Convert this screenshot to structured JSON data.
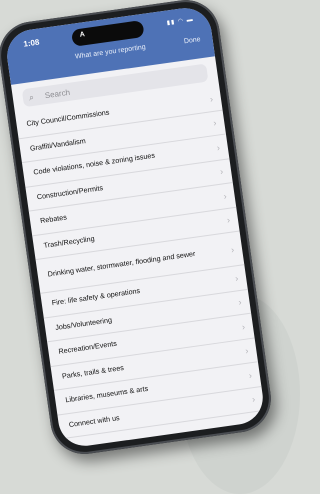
{
  "status": {
    "time": "1:08",
    "icons": "▮▮ ◠ ▬"
  },
  "island_letter": "A",
  "nav": {
    "title": "What are you reporting",
    "done_label": "Done"
  },
  "search": {
    "placeholder": "Search"
  },
  "items": [
    "City Council/Commissions",
    "Graffiti/Vandalism",
    "Code violations, noise & zoning issues",
    "Construction/Permits",
    "Rebates",
    "Trash/Recycling",
    "Drinking water, stormwater, flooding and sewer",
    "Fire: life safety & operations",
    "Jobs/Volunteering",
    "Recreation/Events",
    "Parks, trails & trees",
    "Libraries, museums & arts",
    "Connect with us"
  ],
  "colors": {
    "nav": "#4e72b6",
    "background": "#d7dad6"
  }
}
